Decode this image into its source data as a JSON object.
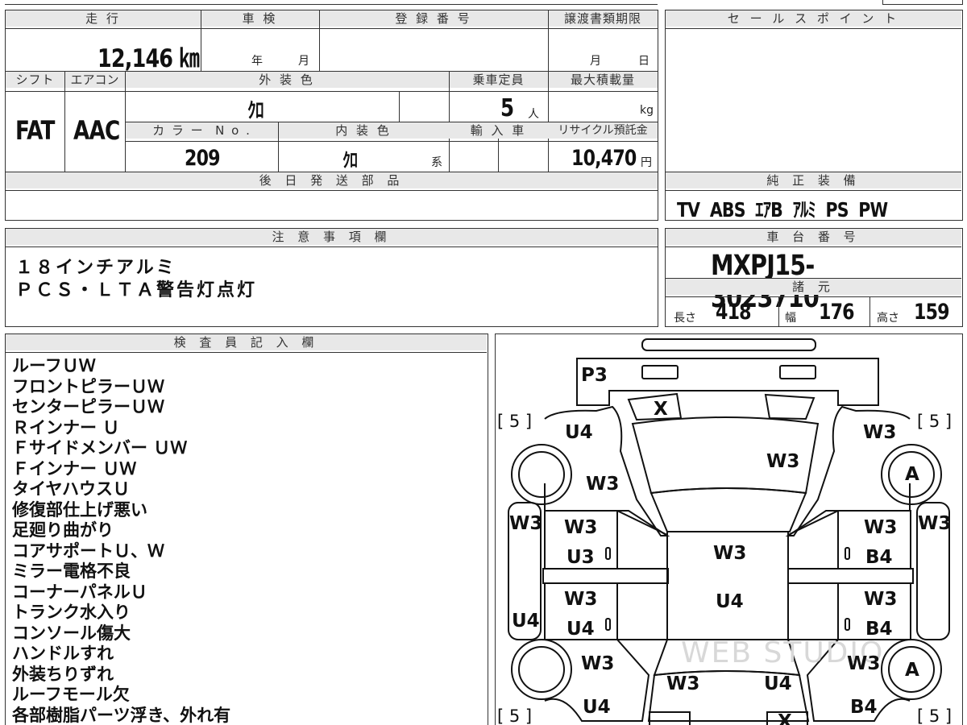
{
  "headers": {
    "mileage": "走 行",
    "shaken": "車 検",
    "registration": "登 録 番 号",
    "transfer_deadline": "譲渡書類期限",
    "sales_point": "セ ー ル ス ポ イ ン ト",
    "shift": "シフト",
    "aircon": "エアコン",
    "exterior_color": "外 装 色",
    "capacity": "乗車定員",
    "max_load": "最大積載量",
    "color_no": "カ ラ ー  N o .",
    "interior_color": "内 装 色",
    "import": "輸 入 車",
    "recycle": "リサイクル預託金",
    "later_parts": "後 日 発 送 部 品",
    "genuine_equipment": "純 正 装 備",
    "notes": "注 意 事 項 欄",
    "chassis_no": "車 台 番 号",
    "specs": "諸 元",
    "inspector": "検 査 員 記 入 欄"
  },
  "values": {
    "mileage": "12,146 ㎞",
    "shaken_year_unit": "年",
    "shaken_month_unit": "月",
    "deadline_month_unit": "月",
    "deadline_day_unit": "日",
    "shift": "FAT",
    "aircon": "AAC",
    "exterior_color": "ｸﾛ",
    "capacity": "5",
    "capacity_unit": "人",
    "max_load_unit": "kg",
    "color_no": "209",
    "interior_color": "ｸﾛ",
    "interior_suffix": "系",
    "recycle": "10,470",
    "recycle_unit": "円",
    "genuine_equipment": "TV  ABS  ｴｱB  ｱﾙﾐ  PS  PW",
    "chassis_no": "MXPJ15-3023710",
    "length_label": "長さ",
    "length": "418",
    "width_label": "幅",
    "width": "176",
    "height_label": "高さ",
    "height": "159"
  },
  "notes": [
    "１８インチアルミ",
    "ＰＣＳ・ＬＴＡ警告灯点灯"
  ],
  "inspector_entries": [
    "ルーフＵＷ",
    "フロントピラーＵＷ",
    "センターピラーＵＷ",
    "Ｒインナー Ｕ",
    "Ｆサイドメンバー ＵＷ",
    "Ｆインナー ＵＷ",
    "タイヤハウスＵ",
    "修復部仕上げ悪い",
    "足廻り曲がり",
    "コアサポートＵ、Ｗ",
    "ミラー電格不良",
    "コーナーパネルＵ",
    "トランク水入り",
    "コンソール傷大",
    "ハンドルすれ",
    "外装ちりずれ",
    "ルーフモール欠",
    "各部樹脂パーツ浮き、外れ有"
  ],
  "diagram": {
    "marks": {
      "p3": "P3",
      "x_front": "X",
      "x_rear": "X",
      "bracket_tl": "[ 5 ]",
      "bracket_tr": "[ 5 ]",
      "bracket_bl": "[ 5 ]",
      "bracket_br": "[ 5 ]",
      "fl_fender": "U4",
      "fr_fender": "W3",
      "bonnet": "W3",
      "left_front_area": "W3",
      "tire_fr": "A",
      "tire_rr": "A",
      "left_mirror": "W3",
      "right_mirror": "W3",
      "fl_door_a": "W3",
      "fl_door_b": "U3",
      "fr_door_a": "W3",
      "fr_door_b": "B4",
      "roof_a": "W3",
      "roof_b": "U4",
      "left_sill": "U4",
      "rl_door_a": "W3",
      "rl_door_b": "U4",
      "rr_door_a": "W3",
      "rr_door_b": "B4",
      "rl_quarter": "W3",
      "rr_quarter": "W3",
      "trunk_a": "W3",
      "trunk_b": "U4",
      "rl_bumper": "U4",
      "rr_bumper": "B4"
    },
    "watermark": "WEB STUDIO"
  }
}
